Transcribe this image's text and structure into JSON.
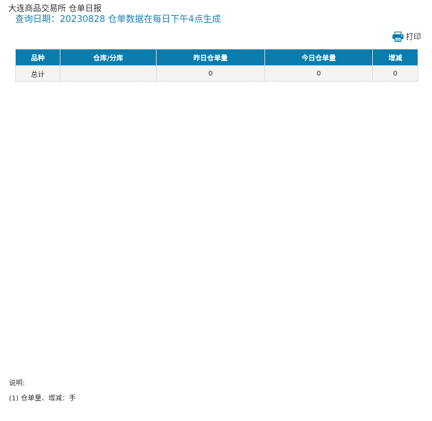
{
  "header": {
    "title": "大连商品交易所 仓单日报",
    "query_date": "查询日期：20230828 仓单数据在每日下午4点生成"
  },
  "toolbar": {
    "print_label": "打印"
  },
  "table": {
    "columns": [
      "品种",
      "仓库/分库",
      "昨日仓单量",
      "今日仓单量",
      "增减"
    ],
    "rows": [
      [
        "总计",
        "",
        "0",
        "0",
        "0"
      ]
    ]
  },
  "notes": {
    "heading": "说明:",
    "items": [
      "(1) 仓单量、增减：手"
    ]
  }
}
